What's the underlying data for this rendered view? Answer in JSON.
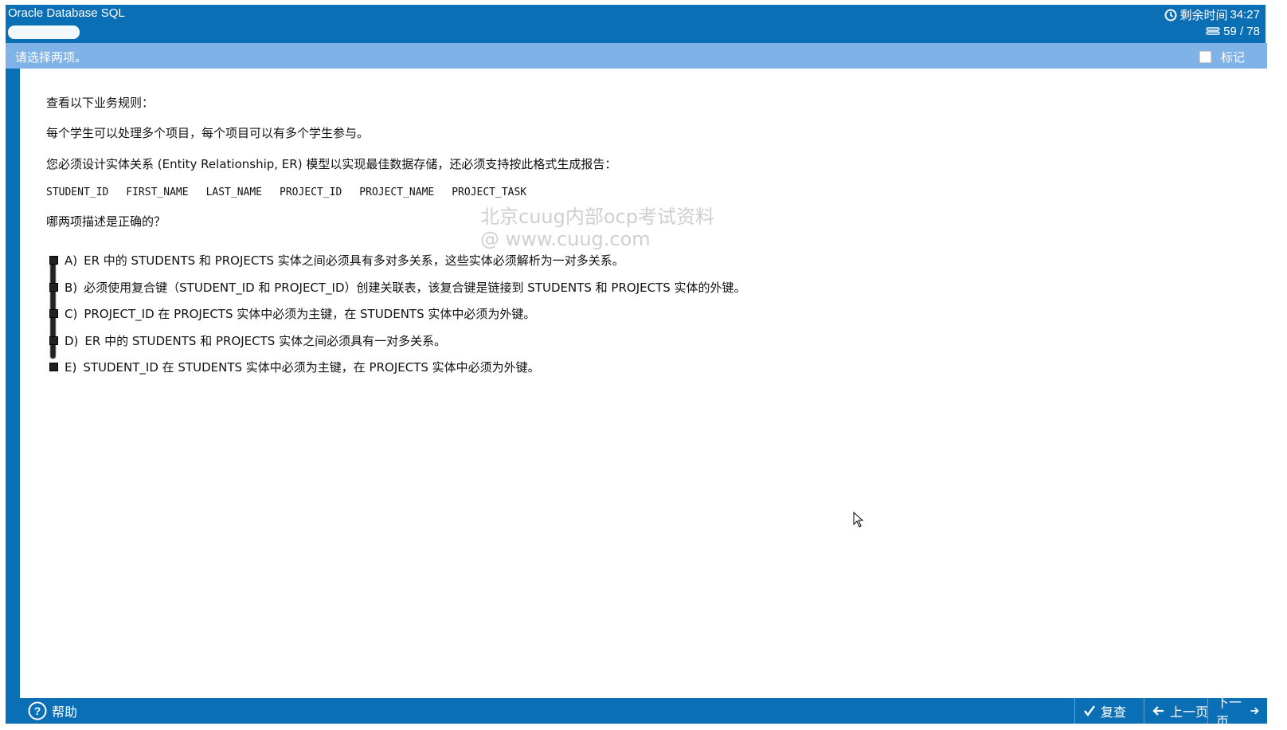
{
  "header": {
    "title": "Oracle Database SQL",
    "timer_label": "剩余时间",
    "timer_value": "34:27",
    "progress": "59 / 78"
  },
  "instruction": {
    "text": "请选择两项。",
    "flag_label": "标记"
  },
  "question": {
    "lines": [
      "查看以下业务规则：",
      "每个学生可以处理多个项目，每个项目可以有多个学生参与。",
      "您必须设计实体关系 (Entity Relationship, ER) 模型以实现最佳数据存储，还必须支持按此格式生成报告：",
      "哪两项描述是正确的？"
    ],
    "fields": [
      "STUDENT_ID",
      "FIRST_NAME",
      "LAST_NAME",
      "PROJECT_ID",
      "PROJECT_NAME",
      "PROJECT_TASK"
    ]
  },
  "watermark": {
    "line1": "北京cuug内部ocp考试资料",
    "line2": "@ www.cuug.com"
  },
  "options": [
    {
      "letter": "A)",
      "text": "ER 中的 STUDENTS 和 PROJECTS 实体之间必须具有多对多关系，这些实体必须解析为一对多关系。"
    },
    {
      "letter": "B)",
      "text": "必须使用复合键（STUDENT_ID 和 PROJECT_ID）创建关联表，该复合键是链接到 STUDENTS 和 PROJECTS 实体的外键。"
    },
    {
      "letter": "C)",
      "text": "PROJECT_ID 在 PROJECTS 实体中必须为主键，在 STUDENTS 实体中必须为外键。"
    },
    {
      "letter": "D)",
      "text": "ER 中的 STUDENTS 和 PROJECTS 实体之间必须具有一对多关系。"
    },
    {
      "letter": "E)",
      "text": "STUDENT_ID 在 STUDENTS 实体中必须为主键，在 PROJECTS 实体中必须为外键。"
    }
  ],
  "footer": {
    "help": "帮助",
    "review": "复查",
    "prev": "上一页",
    "next": "下一页"
  }
}
